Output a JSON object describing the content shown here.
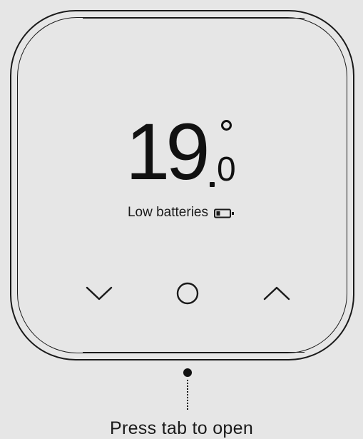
{
  "display": {
    "temperature_whole": "19",
    "temperature_decimal": "0",
    "temperature_unit_symbol": "°",
    "status_text": "Low batteries",
    "status_icon": "battery-low-icon"
  },
  "controls": {
    "decrease_icon": "chevron-down-icon",
    "select_icon": "circle-select-icon",
    "increase_icon": "chevron-up-icon"
  },
  "caption": {
    "text": "Press tab to open"
  },
  "colors": {
    "background": "#e6e6e6",
    "foreground": "#1a1a1a"
  }
}
